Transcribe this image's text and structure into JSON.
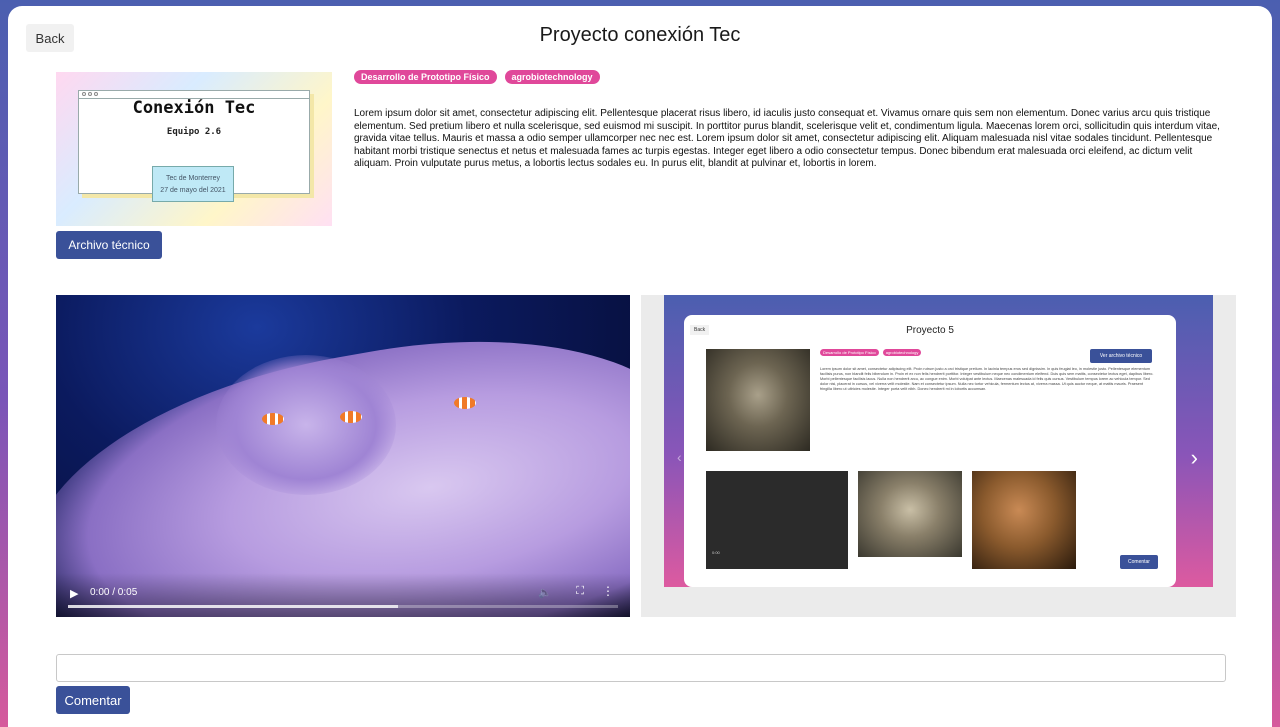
{
  "header": {
    "back_label": "Back",
    "title": "Proyecto conexión Tec"
  },
  "cover": {
    "title": "Conexión Tec",
    "subtitle": "Equipo 2.6",
    "badge_line1": "Tec de Monterrey",
    "badge_line2": "27 de mayo del 2021"
  },
  "tech_file_label": "Archivo técnico",
  "tags": [
    "Desarrollo de Prototipo Físico",
    "agrobiotechnology"
  ],
  "description": "Lorem ipsum dolor sit amet, consectetur adipiscing elit. Pellentesque placerat risus libero, id iaculis justo consequat et. Vivamus ornare quis sem non elementum. Donec varius arcu quis tristique elementum. Sed pretium libero et nulla scelerisque, sed euismod mi suscipit. In porttitor purus blandit, scelerisque velit et, condimentum ligula. Maecenas lorem orci, sollicitudin quis interdum vitae, gravida vitae tellus. Mauris et massa a odio semper ullamcorper nec nec est. Lorem ipsum dolor sit amet, consectetur adipiscing elit. Aliquam malesuada nisl vitae sodales tincidunt. Pellentesque habitant morbi tristique senectus et netus et malesuada fames ac turpis egestas. Integer eget libero a odio consectetur tempus. Donec bibendum erat malesuada orci eleifend, ac dictum velit aliquam. Proin vulputate purus metus, a lobortis lectus sodales eu. In purus elit, blandit at pulvinar et, lobortis in lorem.",
  "video": {
    "time": "0:00 / 0:05",
    "progress": 0.6
  },
  "carousel": {
    "slide": {
      "back_label": "Back",
      "title": "Proyecto 5",
      "tags": [
        "Desarrollo de Prototipo Físico",
        "agrobiotechnology"
      ],
      "tech_button": "Ver archivo técnico",
      "description": "Lorem ipsum dolor sit amet, consectetur adipiscing elit. Proin rutrum justo a orci tristique pretium. In lacinia tempus eros sed dignissim. In quis feugiat leo, in molestie justo. Pellentesque elementum facilisis purus, non blandit felis bibendum in. Proin et ex non felis hendrerit porttitor. Integer vestibulum neque nec condimentum eleifend. Duis quis sem mattis, consectetur lectus eget, dapibus libero. Morbi pellentesque facilisis lacus. Nulla non hendrerit arcu, ac congue enim. Morbi volutpat ante lectus. Maecenas malesuada id felis quis cursus. Vestibulum tempus lorem ac vehicula tempor. Sed dolor nisi, placerat in cursus, vel viverra velit molestie. Nam et consectetur ipsum. Nulla nec tortor vehicula, fermentum lectus at, viverra massa. Ut quis auctor neque, at mattis mauris. Praesent fringilla libero ut ultricies molestie. Integer porta velit nibh. Donec hendrerit mi in lobortis accumsan.",
      "video_time": "0:00",
      "comment_button": "Comentar"
    }
  },
  "comment": {
    "placeholder": "",
    "button_label": "Comentar"
  }
}
